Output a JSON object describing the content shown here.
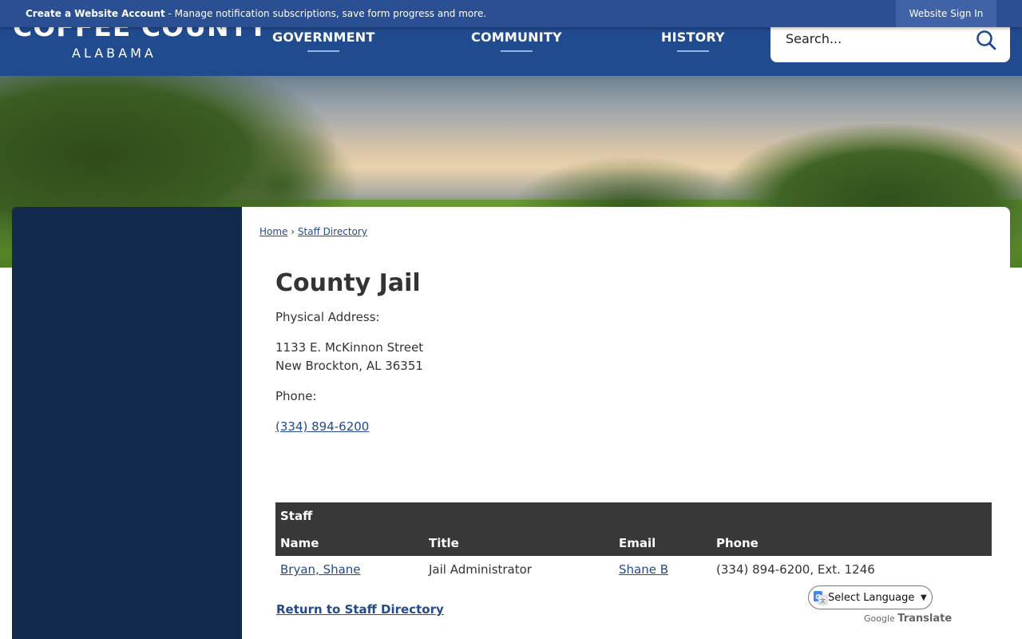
{
  "topbar": {
    "account_link": "Create a Website Account",
    "account_desc": " - Manage notification subscriptions, save form progress and more.",
    "signin_label": "Website Sign In"
  },
  "header": {
    "logo_line1": "COFFEE COUNTY",
    "logo_line2": "ALABAMA",
    "nav": [
      "GOVERNMENT",
      "COMMUNITY",
      "HISTORY"
    ],
    "search_placeholder": "Search..."
  },
  "breadcrumb": {
    "home": "Home",
    "separator": "›",
    "current": "Staff Directory"
  },
  "department": {
    "title": "County Jail",
    "address_label": "Physical Address:",
    "address_line1": "1133 E. McKinnon Street",
    "address_line2": "New Brockton, AL 36351",
    "phone_label": "Phone:",
    "phone": "(334) 894-6200"
  },
  "staff": {
    "caption": "Staff",
    "columns": [
      "Name",
      "Title",
      "Email",
      "Phone"
    ],
    "rows": [
      {
        "name": "Bryan, Shane",
        "title": "Jail Administrator",
        "email": "Shane B",
        "phone": "(334) 894-6200, Ext. 1246"
      }
    ]
  },
  "return_link": "Return to Staff Directory",
  "translate": {
    "select_label": "Select Language",
    "powered_google": "Google",
    "powered_translate": "Translate"
  },
  "colors": {
    "header_bg": "#214b8f",
    "sidebar_bg": "#122a4d",
    "link": "#244a8a",
    "table_head": "#383838"
  }
}
